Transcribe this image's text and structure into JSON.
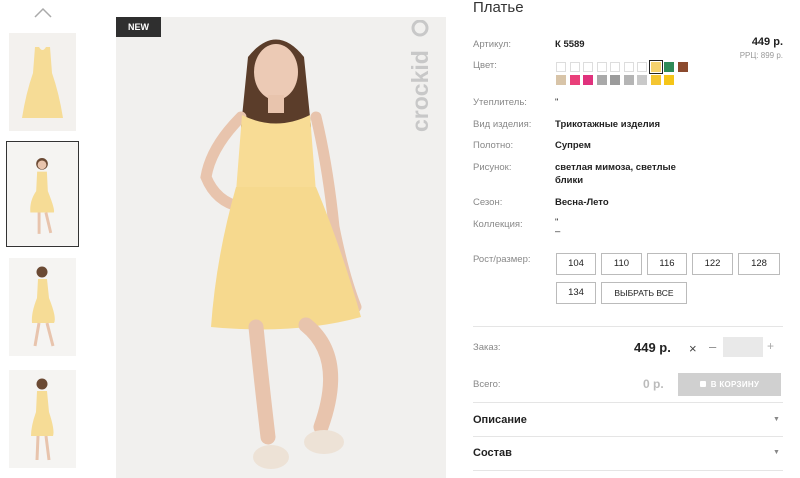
{
  "badge_new": "NEW",
  "brand_logo_text": "crockid",
  "product": {
    "title": "Платье",
    "price": "449 р.",
    "rrc": "РРЦ: 899 р."
  },
  "attributes": {
    "article": {
      "label": "Артикул:",
      "value": "К 5589"
    },
    "color": {
      "label": "Цвет:"
    },
    "insulation": {
      "label": "Утеплитель:",
      "value": "\""
    },
    "product_type": {
      "label": "Вид изделия:",
      "value": "Трикотажные изделия"
    },
    "fabric": {
      "label": "Полотно:",
      "value": "Супрем"
    },
    "pattern": {
      "label": "Рисунок:",
      "value_line1": "светлая мимоза, светлые",
      "value_line2": "блики"
    },
    "season": {
      "label": "Сезон:",
      "value": "Весна-Лето"
    },
    "collection": {
      "label": "Коллекция:",
      "value_line1": "\"",
      "value_line2": "–"
    },
    "sizes_label": "Рост/размер:"
  },
  "color_swatches_row1": [
    "#ffffff",
    "#ffffff",
    "#ffffff",
    "#ffffff",
    "#ffffff",
    "#ffffff",
    "#ffffff",
    "#f5d26e",
    "#2e8b57",
    "#8b4a2e"
  ],
  "color_swatches_row2": [
    "#d8c4a8",
    "#e9407a",
    "#e0327d",
    "#a9a9a9",
    "#9b9b9b",
    "#b5b5b5",
    "#c9c9c9",
    "#f4c531",
    "#f5c518"
  ],
  "sizes": [
    "104",
    "110",
    "116",
    "122",
    "128",
    "134"
  ],
  "select_all": "ВЫБРАТЬ ВСЕ",
  "order": {
    "label": "Заказ:",
    "price": "449 р.",
    "multiply": "×",
    "minus": "–",
    "qty": "",
    "plus": "+"
  },
  "total": {
    "label": "Всего:",
    "value": "0 р.",
    "cart_button": "В КОРЗИНУ"
  },
  "accordion": {
    "description": "Описание",
    "composition": "Состав"
  }
}
